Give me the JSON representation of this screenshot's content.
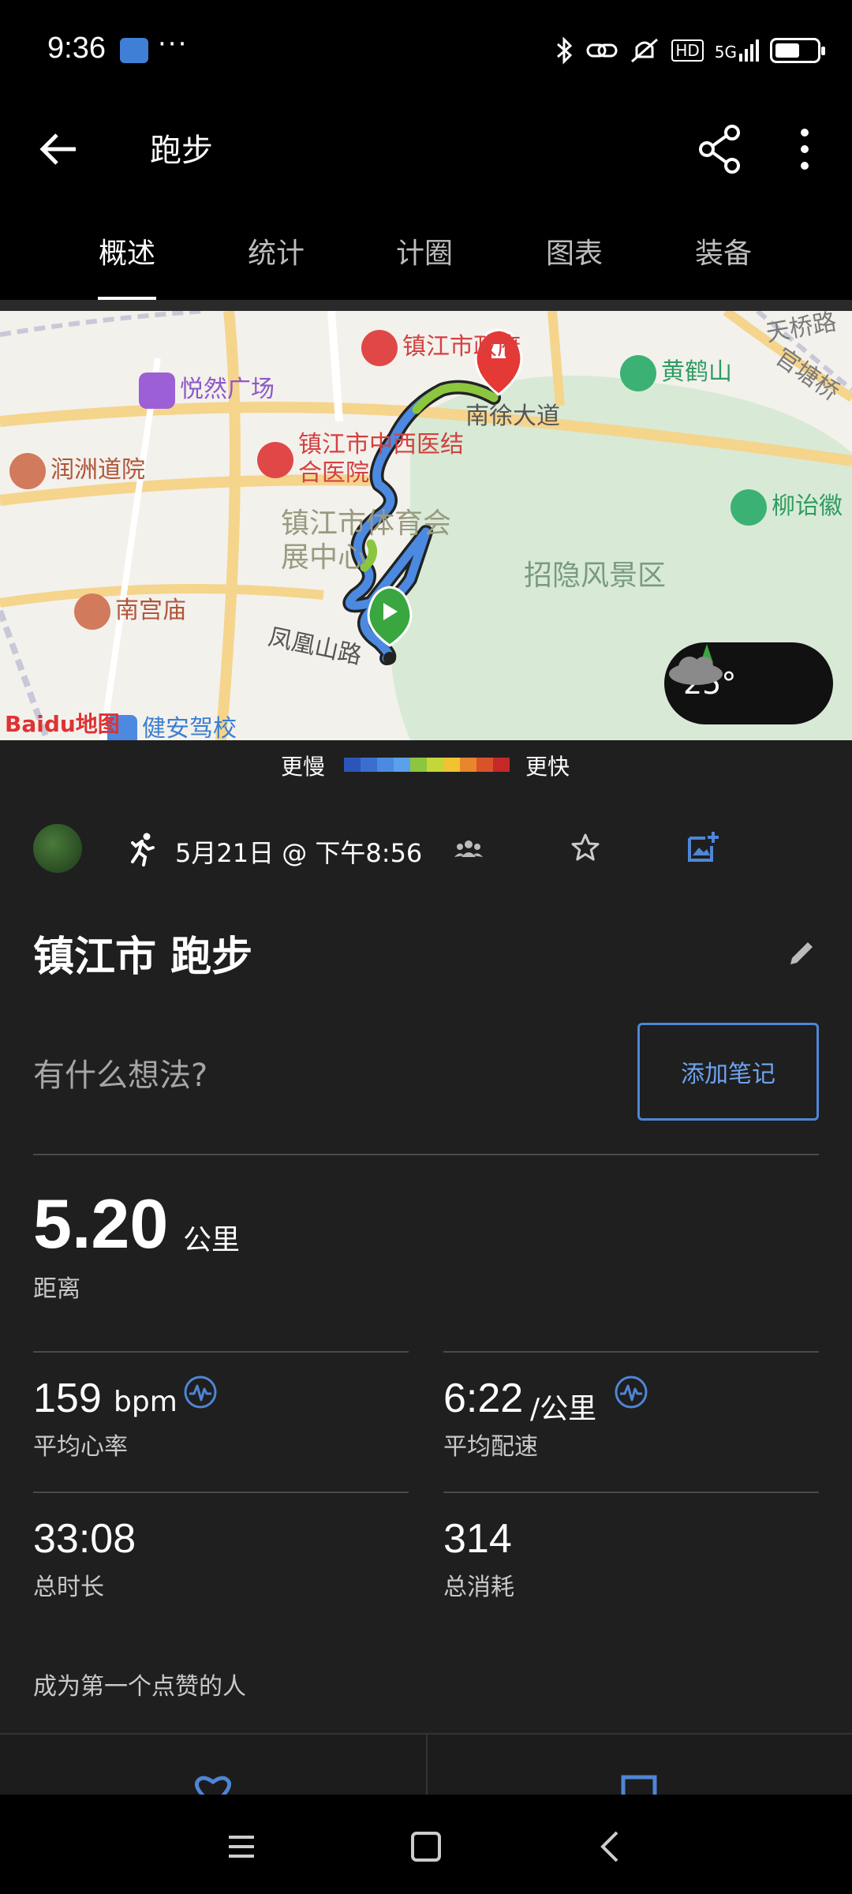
{
  "status_bar": {
    "time": "9:36",
    "more": "···",
    "icons": [
      "bluetooth-icon",
      "link-icon",
      "mute-icon",
      "hd-icon",
      "signal-5g-icon",
      "battery-icon"
    ],
    "hd": "HD",
    "network": "5G",
    "battery_level": 0.6
  },
  "app_bar": {
    "title": "跑步",
    "back_icon": "arrow-left-icon",
    "share_icon": "share-icon",
    "menu_icon": "more-vert-icon"
  },
  "tabs": [
    {
      "label": "概述",
      "active": true
    },
    {
      "label": "统计",
      "active": false
    },
    {
      "label": "计圈",
      "active": false
    },
    {
      "label": "图表",
      "active": false
    },
    {
      "label": "装备",
      "active": false
    }
  ],
  "map": {
    "pois": {
      "gov": "镇江市政府",
      "yueran": "悦然广场",
      "huanghe": "黄鹤山",
      "guantang": "官塘桥",
      "runzhou": "润洲道院",
      "hospital": "镇江市中西医结合医院",
      "sports": "镇江市体育会展中心",
      "zhaoyin": "招隐风景区",
      "liuyi": "柳诒徽",
      "nangong": "南宫庙",
      "fenghuang": "凤凰山路",
      "jianan": "健安驾校",
      "road_nanxu": "南徐大道",
      "tianqiao": "天桥路"
    },
    "weather": {
      "temp": "25°",
      "icon": "cloudy-night-icon"
    },
    "attribution": "Baidu地图"
  },
  "pace_legend": {
    "slower": "更慢",
    "faster": "更快",
    "colors": [
      "#2b55b8",
      "#3a6fd0",
      "#4b8ae0",
      "#5aa0ea",
      "#8cc63f",
      "#c3d63a",
      "#f1c232",
      "#e8862c",
      "#d9532a",
      "#c62828"
    ]
  },
  "activity": {
    "type_icon": "running-icon",
    "date": "5月21日 @ 下午8:56",
    "title": "镇江市 跑步",
    "note_prompt": "有什么想法?",
    "add_note": "添加笔记"
  },
  "stats": {
    "distance": {
      "value": "5.20",
      "unit": "公里",
      "label": "距离"
    },
    "heart_rate": {
      "value": "159",
      "unit": "bpm",
      "label": "平均心率"
    },
    "pace": {
      "value": "6:22",
      "unit": "/公里",
      "label": "平均配速"
    },
    "duration": {
      "value": "33:08",
      "label": "总时长"
    },
    "calories": {
      "value": "314",
      "label": "总消耗"
    }
  },
  "social": {
    "kudos_prompt": "成为第一个点赞的人"
  },
  "theme": {
    "accent": "#4e86d6",
    "background": "#1f1f1f"
  }
}
